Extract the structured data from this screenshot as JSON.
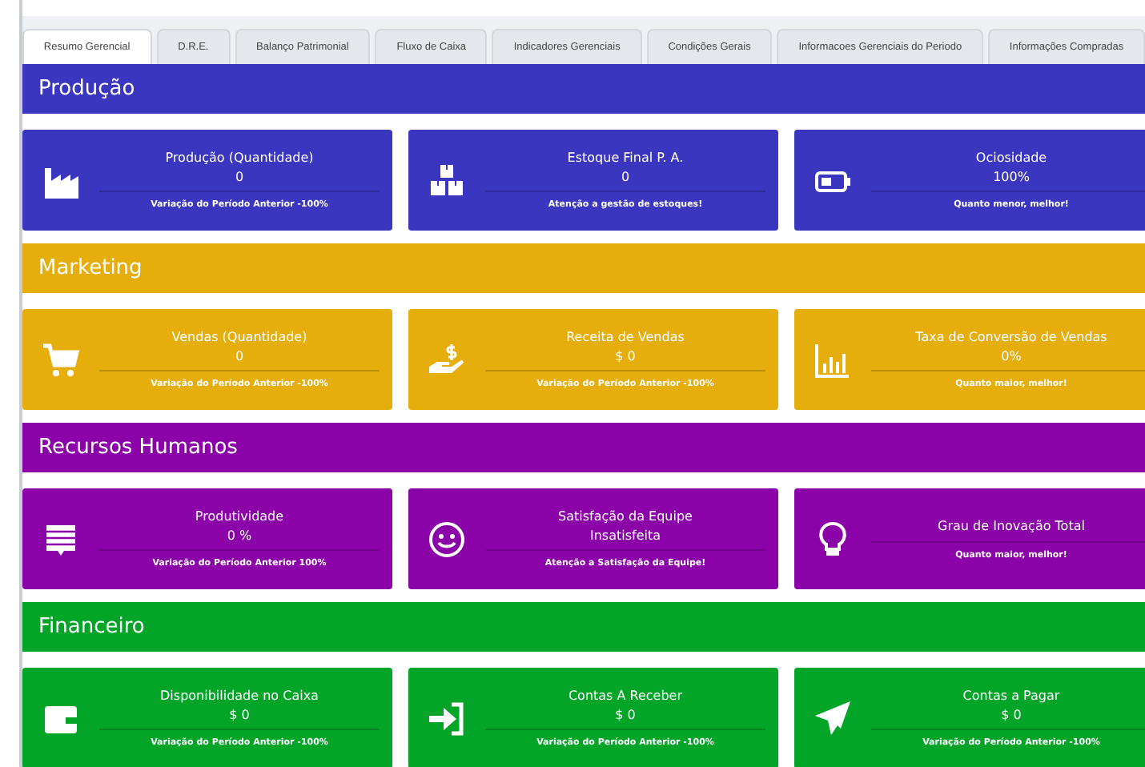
{
  "tabs": [
    {
      "label": "Resumo Gerencial",
      "selected": true
    },
    {
      "label": "D.R.E.",
      "selected": false
    },
    {
      "label": "Balanço Patrimonial",
      "selected": false
    },
    {
      "label": "Fluxo de Caixa",
      "selected": false
    },
    {
      "label": "Indicadores Gerenciais",
      "selected": false
    },
    {
      "label": "Condições Gerais",
      "selected": false
    },
    {
      "label": "Informacoes Gerenciais do Periodo",
      "selected": false
    },
    {
      "label": "Informações Compradas",
      "selected": false
    }
  ],
  "sections": [
    {
      "title": "Produção",
      "color": "#3b36bf",
      "cards": [
        {
          "title": "Produção (Quantidade)",
          "value": "0",
          "note": "Variação do Período Anterior -100%"
        },
        {
          "title": "Estoque Final P. A.",
          "value": "0",
          "note": "Atenção a gestão de estoques!"
        },
        {
          "title": "Ociosidade",
          "value": "100%",
          "note": "Quanto menor, melhor!"
        }
      ]
    },
    {
      "title": "Marketing",
      "color": "#e5ae0d",
      "cards": [
        {
          "title": "Vendas (Quantidade)",
          "value": "0",
          "note": "Variação do Período Anterior -100%"
        },
        {
          "title": "Receita de Vendas",
          "value": "$ 0",
          "note": "Variação do Período Anterior -100%"
        },
        {
          "title": "Taxa de Conversão de Vendas",
          "value": "0%",
          "note": "Quanto maior, melhor!"
        }
      ]
    },
    {
      "title": "Recursos Humanos",
      "color": "#8a02a8",
      "cards": [
        {
          "title": "Produtividade",
          "value": "0 %",
          "note": "Variação do Período Anterior 100%"
        },
        {
          "title": "Satisfação da Equipe",
          "value": "Insatisfeita",
          "note": "Atenção a Satisfação da Equipe!"
        },
        {
          "title": "Grau de Inovação Total",
          "note": "Quanto maior, melhor!"
        }
      ]
    },
    {
      "title": "Financeiro",
      "color": "#03a529",
      "cards": [
        {
          "title": "Disponibilidade no Caixa",
          "value": "$ 0",
          "note": "Variação do Período Anterior -100%"
        },
        {
          "title": "Contas A Receber",
          "value": "$ 0",
          "note": "Variação do Período Anterior -100%"
        },
        {
          "title": "Contas a Pagar",
          "value": "$ 0",
          "note": "Variação do Período Anterior -100%"
        }
      ]
    }
  ]
}
